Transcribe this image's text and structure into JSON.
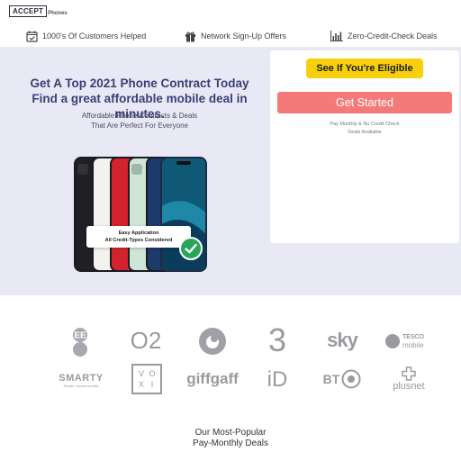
{
  "logo": {
    "main": "ACCEPT",
    "sub": "Phones"
  },
  "features": [
    {
      "label": "1000's Of Customers Helped",
      "icon": "calendar-check-icon"
    },
    {
      "label": "Network Sign-Up Offers",
      "icon": "gift-icon"
    },
    {
      "label": "Zero-Credit-Check Deals",
      "icon": "bar-chart-icon"
    }
  ],
  "hero": {
    "title_line1": "Get A Top 2021 Phone Contract Today",
    "title_line2": "Find a great affordable mobile deal in minutes.",
    "subtitle_line1": "Affordable Phone Contracts & Deals",
    "subtitle_line2": "That Are Perfect For Everyone",
    "badge_line1": "Easy Application",
    "badge_line2": "All Credit-Types Considered"
  },
  "card": {
    "eligible_label": "See If You're Eligible",
    "cta_label": "Get Started",
    "note_line1": "Pay Monthly & No Credit Check",
    "note_line2": "Deals Available"
  },
  "networks": {
    "ee": "EE",
    "o2": "O2",
    "vodafone": "vodafone",
    "three": "3",
    "sky": "sky",
    "tesco_line1": "TESCO",
    "tesco_line2": "mobile",
    "smarty": "SMARTY",
    "smarty_tag": "Simple, honest mobile",
    "voxi": [
      "V",
      "O",
      "X",
      "I"
    ],
    "giffgaff": "giffgaff",
    "id": "iD",
    "bt": "BT",
    "plusnet": "plusnet"
  },
  "popular": {
    "line1": "Our Most-Popular",
    "line2": "Pay-Monthly Deals"
  },
  "colors": {
    "hero_bg": "#e9e9f6",
    "title": "#3a3e74",
    "eligible": "#f7cf0d",
    "cta": "#f47a7a",
    "check": "#2aa55a",
    "logo_grey": "#9a9aa0"
  }
}
